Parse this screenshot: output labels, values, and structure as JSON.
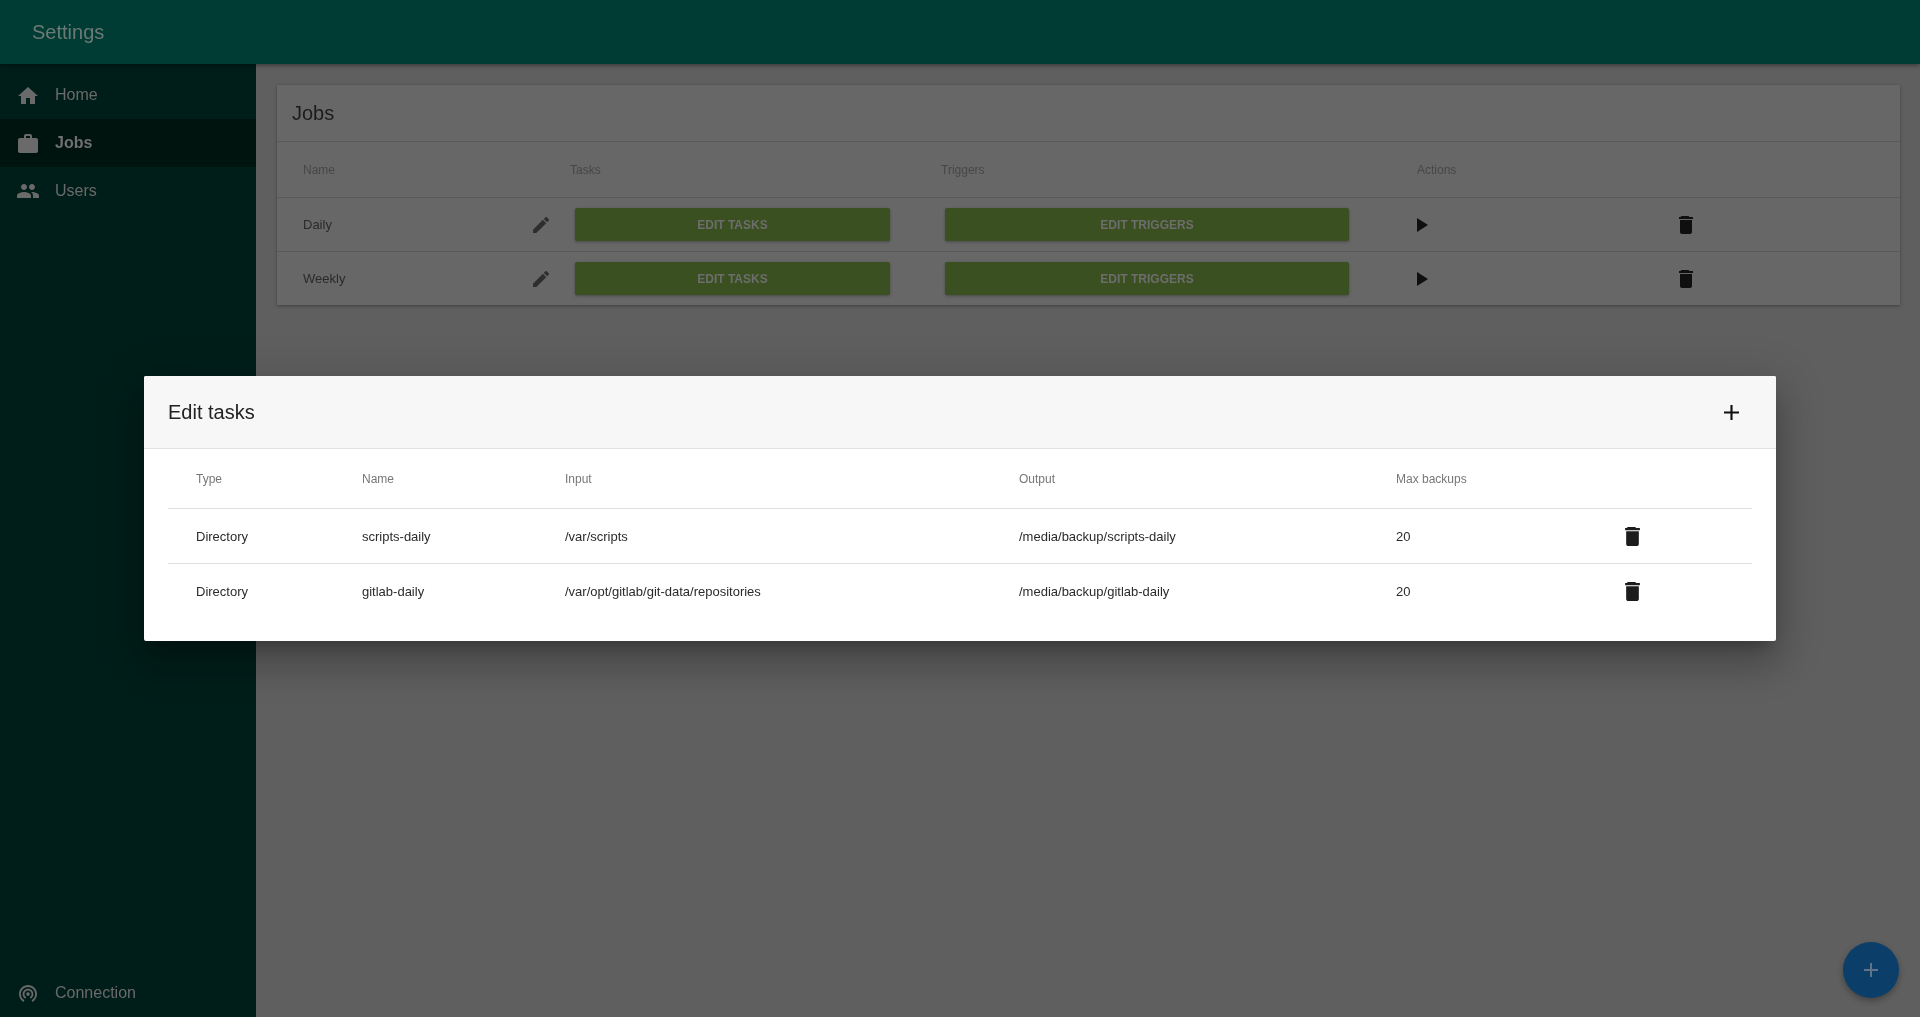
{
  "app_bar": {
    "title": "Settings"
  },
  "sidebar": {
    "items": [
      {
        "label": "Home",
        "selected": false
      },
      {
        "label": "Jobs",
        "selected": true
      },
      {
        "label": "Users",
        "selected": false
      }
    ],
    "footer_item": {
      "label": "Connection"
    }
  },
  "jobs_card": {
    "title": "Jobs",
    "columns": [
      "Name",
      "Tasks",
      "Triggers",
      "Actions"
    ],
    "rows": [
      {
        "name": "Daily",
        "tasks_button": "EDIT TASKS",
        "triggers_button": "EDIT TRIGGERS"
      },
      {
        "name": "Weekly",
        "tasks_button": "EDIT TASKS",
        "triggers_button": "EDIT TRIGGERS"
      }
    ]
  },
  "dialog": {
    "title": "Edit tasks",
    "columns": [
      "Type",
      "Name",
      "Input",
      "Output",
      "Max backups"
    ],
    "rows": [
      {
        "type": "Directory",
        "name": "scripts-daily",
        "input": "/var/scripts",
        "output": "/media/backup/scripts-daily",
        "max_backups": "20"
      },
      {
        "type": "Directory",
        "name": "gitlab-daily",
        "input": "/var/opt/gitlab/git-data/repositories",
        "output": "/media/backup/gitlab-daily",
        "max_backups": "20"
      }
    ]
  }
}
